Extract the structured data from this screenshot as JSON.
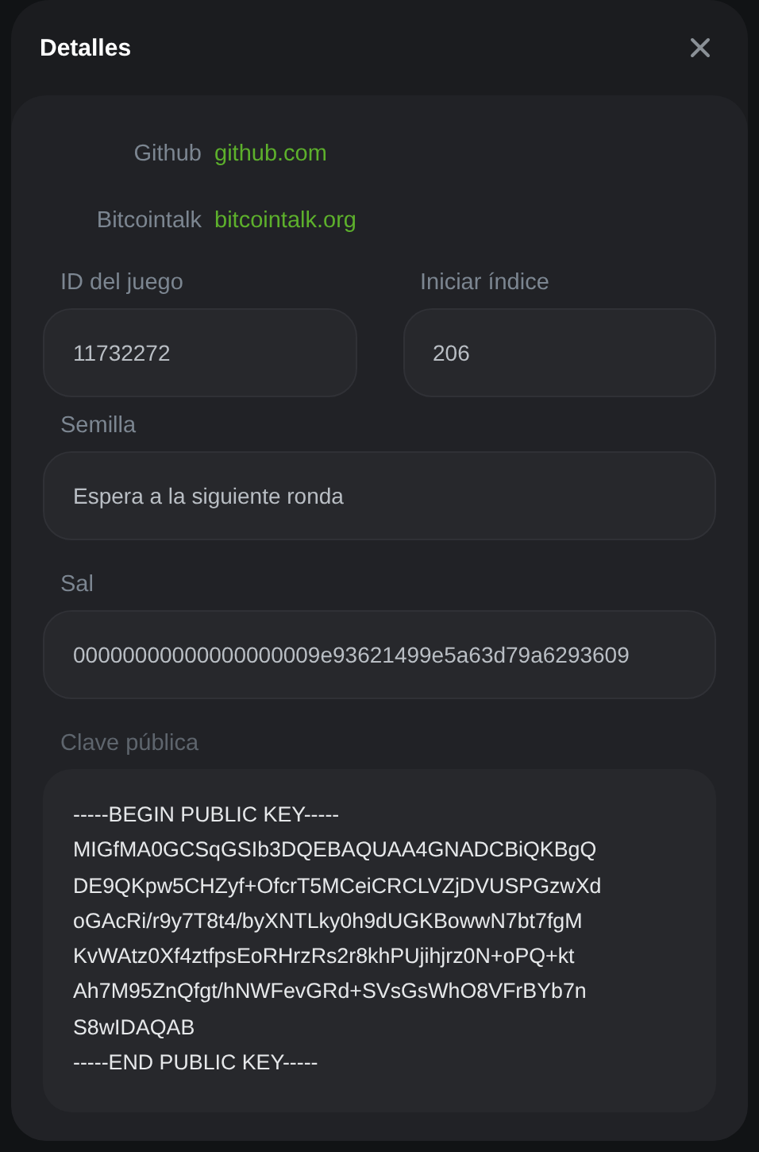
{
  "dialog": {
    "title": "Detalles"
  },
  "links": [
    {
      "label": "Github",
      "url": "github.com"
    },
    {
      "label": "Bitcointalk",
      "url": "bitcointalk.org"
    }
  ],
  "fields_row": [
    {
      "label": "ID del juego",
      "value": "11732272"
    },
    {
      "label": "Iniciar índice",
      "value": "206"
    }
  ],
  "fields": [
    {
      "label": "Semilla",
      "value": "Espera a la siguiente ronda"
    },
    {
      "label": "Sal",
      "value": "00000000000000000009e93621499e5a63d79a6293609"
    }
  ],
  "public_key": {
    "label": "Clave pública",
    "lines": [
      "-----BEGIN PUBLIC KEY-----",
      "MIGfMA0GCSqGSIb3DQEBAQUAA4GNADCBiQKBgQ",
      "DE9QKpw5CHZyf+OfcrT5MCeiCRCLVZjDVUSPGzwXd",
      "oGAcRi/r9y7T8t4/byXNTLky0h9dUGKBowwN7bt7fgM",
      "KvWAtz0Xf4ztfpsEoRHrzRs2r8khPUjihjrz0N+oPQ+kt",
      "Ah7M95ZnQfgt/hNWFevGRd+SVsGsWhO8VFrBYb7n",
      "S8wIDAQAB",
      "-----END PUBLIC KEY-----"
    ]
  }
}
